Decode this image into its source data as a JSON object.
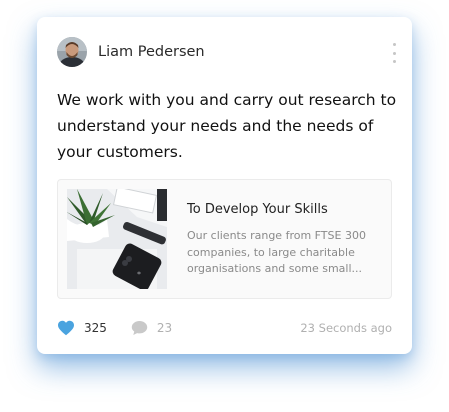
{
  "post": {
    "author": {
      "name": "Liam Pedersen",
      "avatar_icon": "avatar-photo"
    },
    "menu_icon": "vertical-ellipsis-icon",
    "text": "We work with you and carry out research to understand your needs and the needs of your customers.",
    "link_preview": {
      "title": "To Develop Your Skills",
      "description": "Our clients range from FTSE 300 companies, to large charitable organisations and some small...",
      "image": "desk-with-plant-phone-and-laptop-photo"
    },
    "likes": {
      "icon": "heart-icon",
      "count": "325",
      "color": "#4aa3df"
    },
    "comments": {
      "icon": "speech-bubble-icon",
      "count": "23",
      "color": "#c9c9c9"
    },
    "timestamp": "23 Seconds ago"
  },
  "colors": {
    "card_shadow": "#5aa0dc",
    "text": "#111111",
    "muted": "#b0b0b0"
  }
}
